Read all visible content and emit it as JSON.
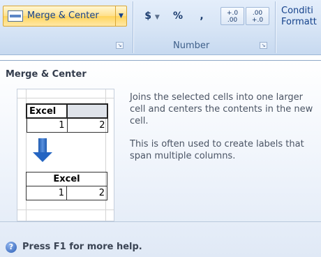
{
  "ribbon": {
    "merge_button_label": "Merge & Center",
    "number_format": {
      "currency_symbol": "$",
      "percent_symbol": "%",
      "comma_symbol": ",",
      "increase_decimal_top": "+.0",
      "increase_decimal_bottom": ".00",
      "decrease_decimal_top": ".00",
      "decrease_decimal_bottom": "+.0"
    },
    "number_group_label": "Number",
    "conditional_formatting_label_line1": "Conditi",
    "conditional_formatting_label_line2": "Formatt"
  },
  "tooltip": {
    "title": "Merge & Center",
    "description": "Joins the selected cells into one larger cell and centers the contents in the new cell.",
    "note": "This is often used to create labels that span multiple columns.",
    "help_text": "Press F1 for more help.",
    "illustration": {
      "before_header": "Excel",
      "before_values": [
        "1",
        "2"
      ],
      "after_header": "Excel",
      "after_values": [
        "1",
        "2"
      ]
    }
  },
  "icons": {
    "merge": "merge-center-icon",
    "launcher": "dialog-launcher-icon",
    "help": "help-icon",
    "arrow": "down-arrow-icon"
  },
  "colors": {
    "ribbon_background": "#d6e4f5",
    "button_highlight": "#ffe08a",
    "arrow_blue": "#2565c2",
    "help_icon_blue": "#2d5fb6"
  }
}
